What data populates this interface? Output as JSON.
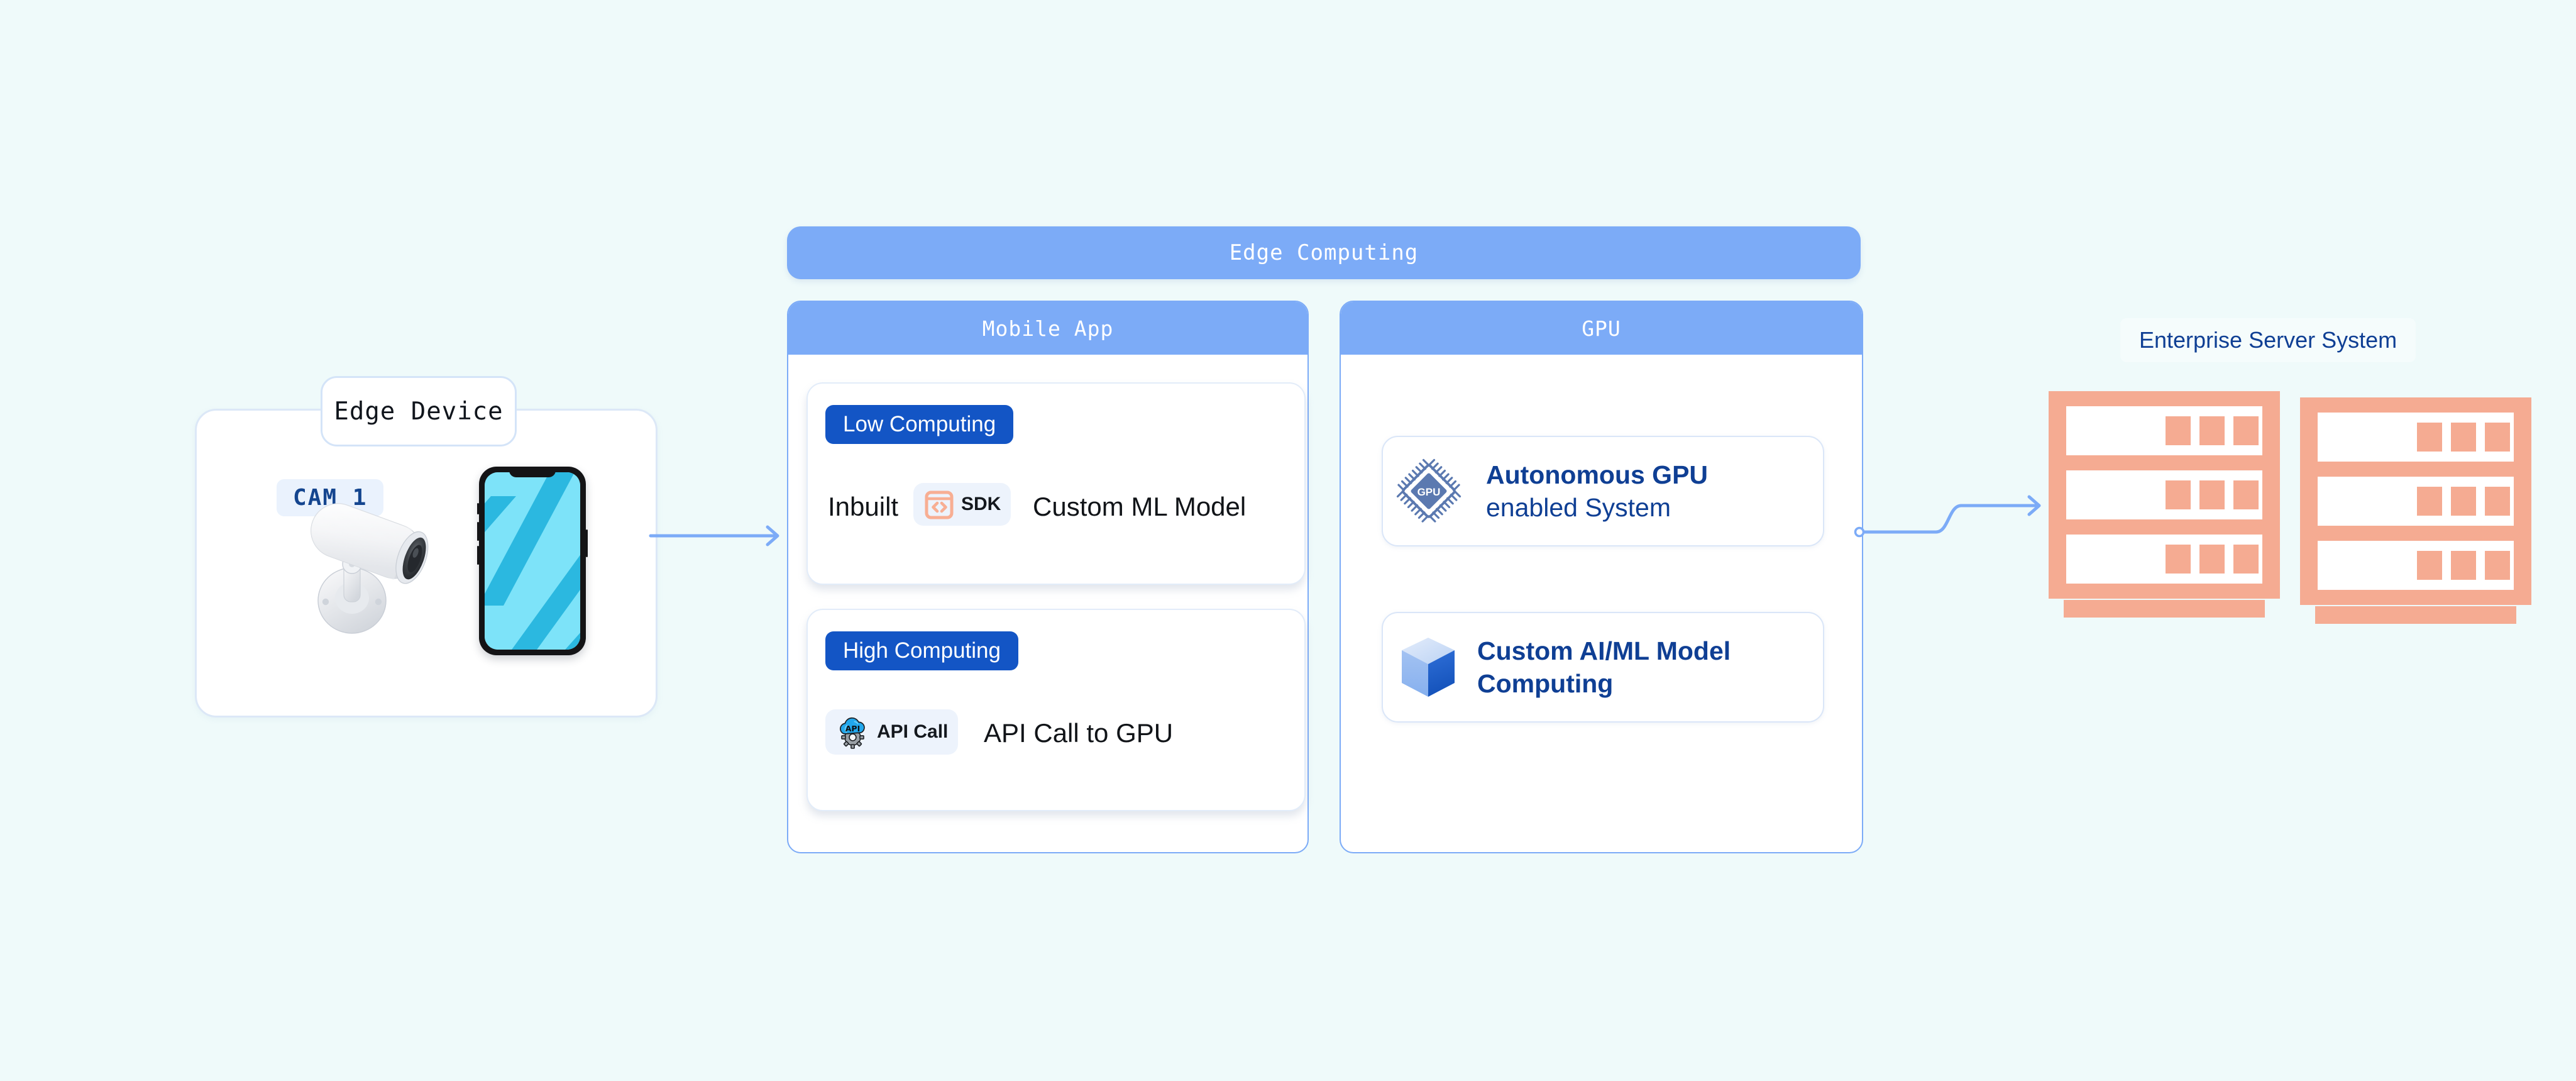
{
  "canvas": {
    "background": "#effafa",
    "accent_blue": "#7cabf7",
    "accent_deep_blue": "#1355c5",
    "accent_navy": "#0f3f94",
    "accent_salmon": "#f5ab92",
    "accent_cyan": "#7de3f9"
  },
  "edge_device": {
    "title": "Edge Device",
    "camera_badge": "CAM 1",
    "camera_icon": "security-camera-icon",
    "phone_icon": "smartphone-icon"
  },
  "edge_computing": {
    "title": "Edge Computing",
    "columns": [
      {
        "title": "Mobile App",
        "cards": [
          {
            "pill": "Low Computing",
            "lead": "Inbuilt",
            "chip_icon": "sdk-code-box-icon",
            "chip_label": "SDK",
            "text": "Custom ML Model"
          },
          {
            "pill": "High Computing",
            "lead": "",
            "chip_icon": "api-cloud-gear-icon",
            "chip_label": "API Call",
            "text": "API Call to GPU"
          }
        ]
      },
      {
        "title": "GPU",
        "cards": [
          {
            "icon": "gpu-chip-icon",
            "line1": "Autonomous GPU",
            "line2": "enabled System"
          },
          {
            "icon": "cube-3d-icon",
            "line1": "Custom AI/ML Model",
            "line2": "Computing"
          }
        ]
      }
    ]
  },
  "enterprise": {
    "title": "Enterprise Server System",
    "rack_icon": "server-rack-icon",
    "rack_count": 2,
    "slots_per_rack": 3,
    "blocks_per_slot": 3
  },
  "connectors": [
    {
      "name": "edge-device-to-mobile-app",
      "kind": "arrow-right"
    },
    {
      "name": "gpu-to-enterprise-server",
      "kind": "s-curve-arrow-right"
    }
  ]
}
